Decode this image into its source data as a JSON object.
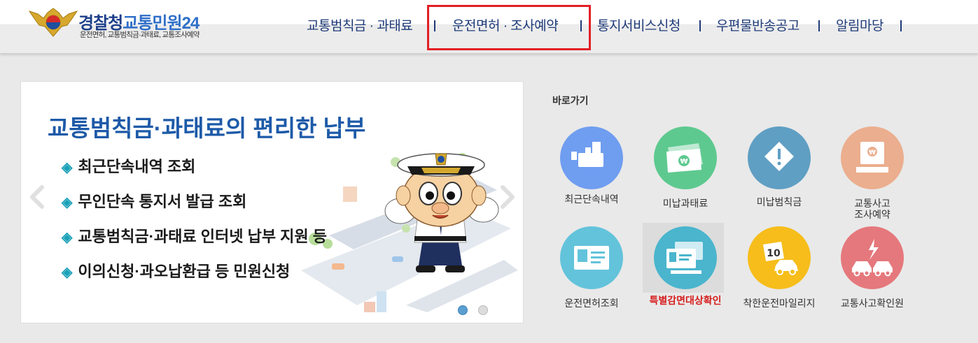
{
  "header": {
    "logo_title_part1": "경찰청",
    "logo_title_part2": "교통민원24",
    "logo_subtitle": "운전면허, 교통범칙금·과태료, 교통조사예약",
    "nav": [
      {
        "label": "교통범칙금 · 과태료"
      },
      {
        "label": "운전면허 · 조사예약"
      },
      {
        "label": "통지서비스신청"
      },
      {
        "label": "우편물반송공고"
      },
      {
        "label": "알림마당"
      }
    ],
    "highlight_color": "#e21f26"
  },
  "banner": {
    "title": "교통범칙금·과태료의 편리한 납부",
    "bullets": [
      "최근단속내역 조회",
      "무인단속 통지서 발급 조회",
      "교통범칙금·과태료 인터넷 납부 지원 등",
      "이의신청·과오납환급 등 민원신청"
    ],
    "bullet_icon": "diamond-bullet-icon",
    "prev_icon": "chevron-left-icon",
    "next_icon": "chevron-right-icon",
    "slide_count": 2,
    "active_slide": 1
  },
  "quick_links": {
    "title": "바로가기",
    "items": [
      {
        "label": "최근단속내역",
        "icon": "camera-icon",
        "color": "#6f9df0"
      },
      {
        "label": "미납과태료",
        "icon": "money-icon",
        "color": "#5ec98f"
      },
      {
        "label": "미납범칙금",
        "icon": "warning-icon",
        "color": "#5f9fc3"
      },
      {
        "label": "교통사고 조사예약",
        "label_line1": "교통사고",
        "label_line2": "조사예약",
        "icon": "terminal-icon",
        "color": "#ebae8e"
      },
      {
        "label": "운전면허조회",
        "icon": "license-card-icon",
        "color": "#63c3db"
      },
      {
        "label": "특별감면대상확인",
        "icon": "license-check-icon",
        "color": "#4ab5cd",
        "highlighted": true
      },
      {
        "label": "착한운전마일리지",
        "icon": "mileage-car-icon",
        "color": "#f6bd1b"
      },
      {
        "label": "교통사고확인원",
        "icon": "car-crash-icon",
        "color": "#e5787c"
      }
    ]
  }
}
